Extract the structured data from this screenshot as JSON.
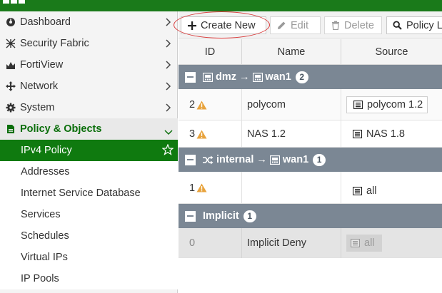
{
  "sidebar": {
    "items": [
      {
        "label": "Dashboard",
        "icon": "dashboard-icon"
      },
      {
        "label": "Security Fabric",
        "icon": "security-fabric-icon"
      },
      {
        "label": "FortiView",
        "icon": "fortiview-icon"
      },
      {
        "label": "Network",
        "icon": "network-icon"
      },
      {
        "label": "System",
        "icon": "gear-icon"
      },
      {
        "label": "Policy & Objects",
        "icon": "policy-objects-icon"
      }
    ],
    "sub_items": [
      {
        "label": "IPv4 Policy"
      },
      {
        "label": "Addresses"
      },
      {
        "label": "Internet Service Database"
      },
      {
        "label": "Services"
      },
      {
        "label": "Schedules"
      },
      {
        "label": "Virtual IPs"
      },
      {
        "label": "IP Pools"
      }
    ]
  },
  "toolbar": {
    "create_new": "Create New",
    "edit": "Edit",
    "delete": "Delete",
    "policy_lookup": "Policy L"
  },
  "table": {
    "columns": [
      "ID",
      "Name",
      "Source"
    ],
    "groups": [
      {
        "from": "dmz",
        "arrow": "→",
        "to": "wan1",
        "count": "2"
      },
      {
        "from": "internal",
        "arrow": "→",
        "to": "wan1",
        "count": "1"
      },
      {
        "label": "Implicit",
        "count": "1"
      }
    ],
    "rows": [
      {
        "id": "2",
        "name": "polycom",
        "source": "polycom 1.2"
      },
      {
        "id": "3",
        "name": "NAS 1.2",
        "source": "NAS 1.8"
      },
      {
        "id": "1",
        "name": "",
        "source": "all"
      },
      {
        "id": "0",
        "name": "Implicit Deny",
        "source": "all"
      }
    ]
  },
  "colors": {
    "accent_green": "#0f7a0f",
    "group_header": "#7b8794",
    "warning": "#e8a33d",
    "highlight_ring": "#d93a3a"
  }
}
